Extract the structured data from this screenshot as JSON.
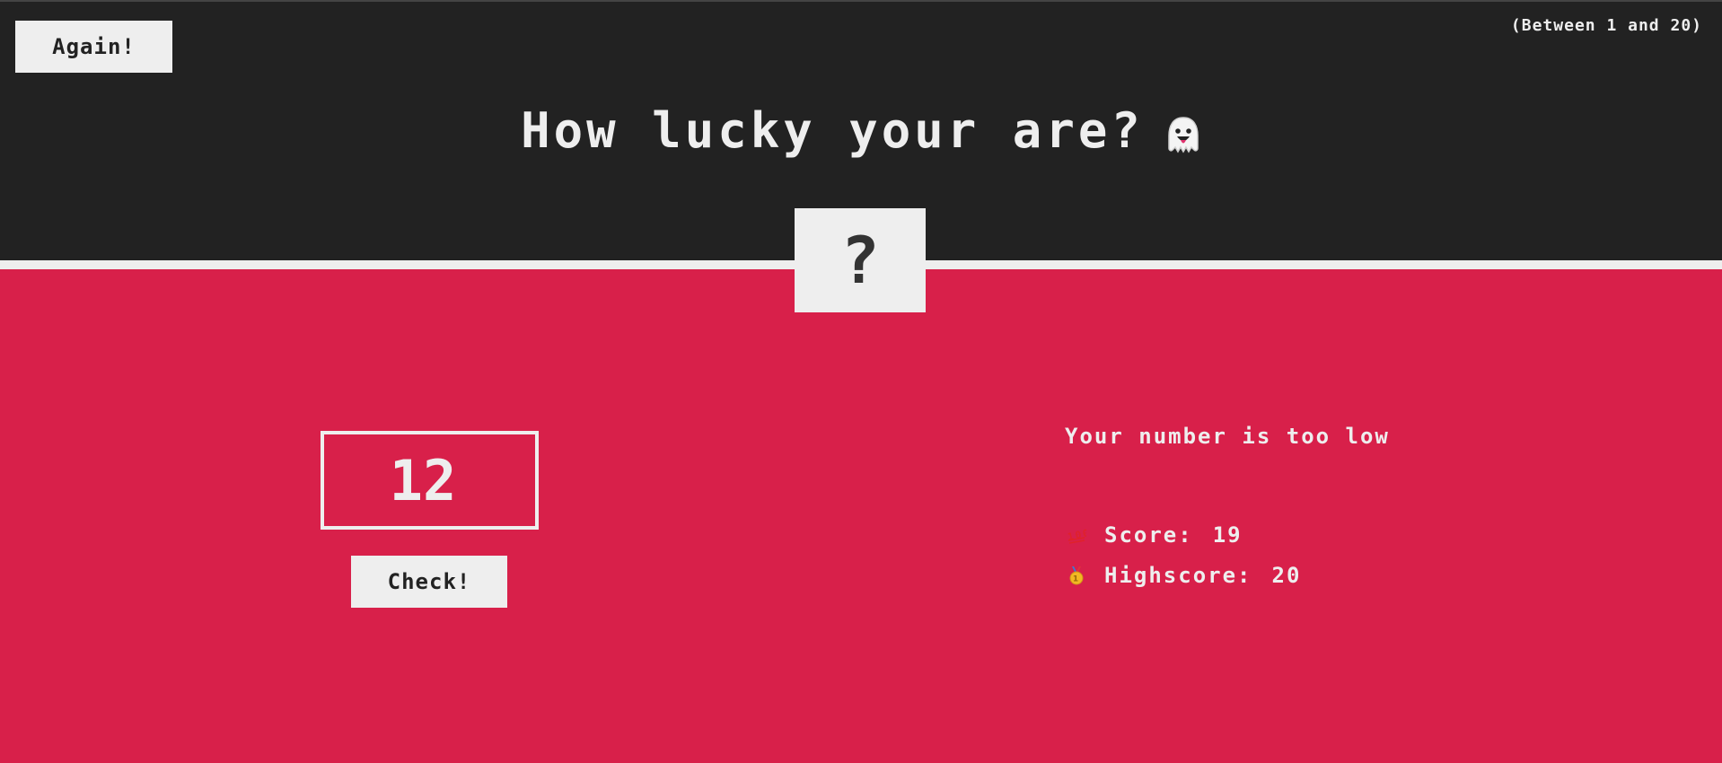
{
  "header": {
    "again_label": "Again!",
    "range_hint": "(Between 1 and 20)",
    "title": "How lucky your are?",
    "title_icon": "ghost-icon",
    "secret_number": "?"
  },
  "main": {
    "guess_value": "12",
    "check_label": "Check!",
    "message": "Your number is too low",
    "score": {
      "icon": "hundred-points-icon",
      "label": "Score:",
      "value": "19"
    },
    "highscore": {
      "icon": "medal-icon",
      "label": "Highscore:",
      "value": "20"
    }
  },
  "colors": {
    "header_bg": "#222222",
    "main_bg": "#d8204a",
    "light": "#eeeeee",
    "dark_text": "#333333"
  }
}
